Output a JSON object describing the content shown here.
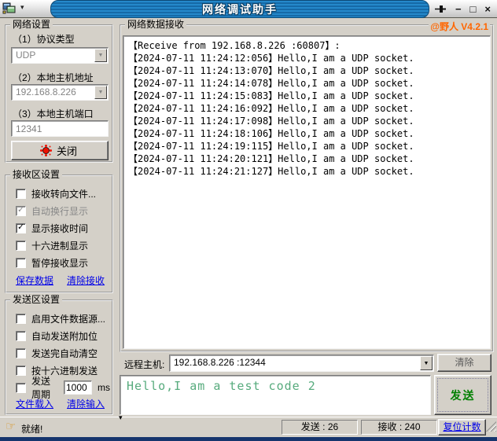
{
  "window": {
    "title": "网络调试助手",
    "version": "@野人 V4.2.1"
  },
  "icons": {
    "menu_arrow": "▾",
    "minimize": "−",
    "maximize": "□",
    "close": "×",
    "combo_arrow": "▼",
    "check": "✓",
    "hand": "☞",
    "splitter_arrow": "▾"
  },
  "colors": {
    "titlebar_blue": "#1c78b4",
    "version_orange": "#ff6600",
    "send_text_green": "#57ab7d",
    "send_button_green": "#008000",
    "led_red": "#ee1100",
    "link_blue": "#0000e8",
    "chrome_gray": "#d4d0c8"
  },
  "network_settings": {
    "title": "网络设置",
    "protocol_label": "（1）协议类型",
    "protocol_value": "UDP",
    "host_label": "（2）本地主机地址",
    "host_value": "192.168.8.226",
    "port_label": "（3）本地主机端口",
    "port_value": "12341",
    "close_button": "关闭"
  },
  "receive_settings": {
    "title": "接收区设置",
    "options": [
      {
        "label": "接收转向文件...",
        "checked": false,
        "disabled": false
      },
      {
        "label": "自动换行显示",
        "checked": true,
        "disabled": true
      },
      {
        "label": "显示接收时间",
        "checked": true,
        "disabled": false
      },
      {
        "label": "十六进制显示",
        "checked": false,
        "disabled": false
      },
      {
        "label": "暂停接收显示",
        "checked": false,
        "disabled": false
      }
    ],
    "links": [
      "保存数据",
      "清除接收"
    ]
  },
  "send_settings": {
    "title": "发送区设置",
    "options": [
      {
        "label": "启用文件数据源...",
        "checked": false,
        "disabled": false
      },
      {
        "label": "自动发送附加位",
        "checked": false,
        "disabled": false
      },
      {
        "label": "发送完自动清空",
        "checked": false,
        "disabled": false
      },
      {
        "label": "按十六进制发送",
        "checked": false,
        "disabled": false
      }
    ],
    "period": {
      "label": "发送周期",
      "checked": false,
      "value": "1000",
      "unit": "ms"
    },
    "links": [
      "文件载入",
      "清除输入"
    ]
  },
  "receive_area": {
    "title": "网络数据接收",
    "log_lines": [
      "【Receive from 192.168.8.226 :60807】:",
      "【2024-07-11 11:24:12:056】Hello,I am a UDP socket.",
      "【2024-07-11 11:24:13:070】Hello,I am a UDP socket.",
      "【2024-07-11 11:24:14:078】Hello,I am a UDP socket.",
      "【2024-07-11 11:24:15:083】Hello,I am a UDP socket.",
      "【2024-07-11 11:24:16:092】Hello,I am a UDP socket.",
      "【2024-07-11 11:24:17:098】Hello,I am a UDP socket.",
      "【2024-07-11 11:24:18:106】Hello,I am a UDP socket.",
      "【2024-07-11 11:24:19:115】Hello,I am a UDP socket.",
      "【2024-07-11 11:24:20:121】Hello,I am a UDP socket.",
      "【2024-07-11 11:24:21:127】Hello,I am a UDP socket."
    ]
  },
  "remote": {
    "label": "远程主机:",
    "value": "192.168.8.226 :12344",
    "clear_button": "清除"
  },
  "send_area": {
    "text": "Hello,I am a test code 2",
    "send_button": "发送"
  },
  "statusbar": {
    "status": "就绪!",
    "sep": " : ",
    "sent": {
      "label": "发送",
      "value": "26"
    },
    "recv": {
      "label": "接收",
      "value": "240"
    },
    "reset_button": "复位计数"
  }
}
